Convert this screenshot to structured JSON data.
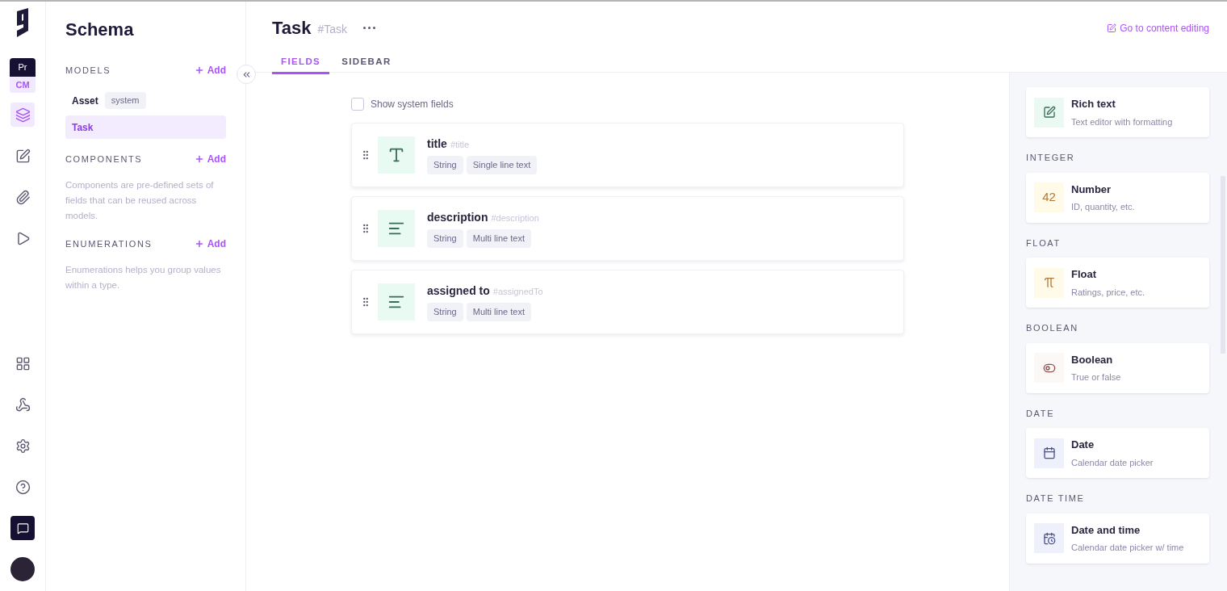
{
  "rail": {
    "project_badge": {
      "top": "Pr",
      "bottom": "CM"
    },
    "nav": [
      {
        "kind": "schema",
        "selected": true
      },
      {
        "kind": "content",
        "selected": false
      },
      {
        "kind": "assets",
        "selected": false
      },
      {
        "kind": "playground",
        "selected": false
      }
    ],
    "bottom": [
      {
        "kind": "apps",
        "selected": false
      },
      {
        "kind": "webhooks",
        "selected": false
      },
      {
        "kind": "settings",
        "selected": false
      },
      {
        "kind": "help",
        "selected": false
      },
      {
        "kind": "chat",
        "selected": false
      }
    ]
  },
  "sidebar": {
    "title": "Schema",
    "sections": [
      {
        "heading": "MODELS",
        "add": "Add",
        "items": [
          {
            "label": "Asset",
            "badge": "system",
            "selected": false
          },
          {
            "label": "Task",
            "selected": true
          }
        ]
      },
      {
        "heading": "COMPONENTS",
        "add": "Add",
        "description": "Components are pre-defined sets of fields that can be reused across models."
      },
      {
        "heading": "ENUMERATIONS",
        "add": "Add",
        "description": "Enumerations helps you group values within a type."
      }
    ]
  },
  "header": {
    "title": "Task",
    "api_id": "#Task",
    "link": "Go to content editing"
  },
  "tabs": [
    {
      "label": "FIELDS",
      "selected": true
    },
    {
      "label": "SIDEBAR",
      "selected": false
    }
  ],
  "show_system_fields": {
    "label": "Show system fields",
    "checked": false
  },
  "fields": [
    {
      "name": "title",
      "api_id": "#title",
      "kind": "single",
      "tags": [
        "String",
        "Single line text"
      ]
    },
    {
      "name": "description",
      "api_id": "#description",
      "kind": "multi",
      "tags": [
        "String",
        "Multi line text"
      ]
    },
    {
      "name": "assigned to",
      "api_id": "#assignedTo",
      "kind": "multi",
      "tags": [
        "String",
        "Multi line text"
      ]
    }
  ],
  "field_types": [
    {
      "items": [
        {
          "kind": "richtext",
          "title": "Rich text",
          "description": "Text editor with formatting"
        }
      ]
    },
    {
      "heading": "INTEGER",
      "items": [
        {
          "kind": "number",
          "icon_text": "42",
          "title": "Number",
          "description": "ID, quantity, etc."
        }
      ]
    },
    {
      "heading": "FLOAT",
      "items": [
        {
          "kind": "float",
          "title": "Float",
          "description": "Ratings, price, etc."
        }
      ]
    },
    {
      "heading": "BOOLEAN",
      "items": [
        {
          "kind": "boolean",
          "title": "Boolean",
          "description": "True or false"
        }
      ]
    },
    {
      "heading": "DATE",
      "items": [
        {
          "kind": "date",
          "title": "Date",
          "description": "Calendar date picker"
        }
      ]
    },
    {
      "heading": "DATE TIME",
      "items": [
        {
          "kind": "datetime",
          "title": "Date and time",
          "description": "Calendar date picker w/ time"
        }
      ]
    }
  ]
}
